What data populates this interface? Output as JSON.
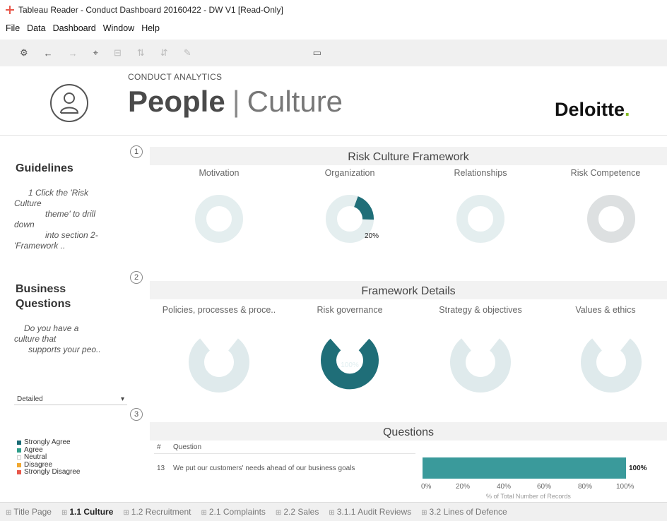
{
  "window": {
    "title": "Tableau Reader - Conduct Dashboard 20160422 - DW V1 [Read-Only]"
  },
  "menu": [
    "File",
    "Data",
    "Dashboard",
    "Window",
    "Help"
  ],
  "header": {
    "kicker": "CONDUCT ANALYTICS",
    "title_bold": "People",
    "title_sep": "|",
    "title_light": "Culture",
    "brand": "Deloitte",
    "brand_dot": ".",
    "brand_dot_color": "#86bc25"
  },
  "sidebar": {
    "guidelines_heading": "Guidelines",
    "guidelines_lines": [
      "1  Click the 'Risk",
      "Culture",
      "theme' to drill",
      "down",
      "into section 2-",
      "'Framework .."
    ],
    "business_heading_1": "Business",
    "business_heading_2": "Questions",
    "business_lines": [
      "Do you have a",
      "culture that",
      "supports your peo.."
    ],
    "filter_value": "Detailed",
    "legend": [
      {
        "label": "Strongly Agree",
        "color": "#1a6b75"
      },
      {
        "label": "Agree",
        "color": "#2e9e8a"
      },
      {
        "label": "Neutral",
        "color": "#ffffff"
      },
      {
        "label": "Disagree",
        "color": "#f0a830"
      },
      {
        "label": "Strongly Disagree",
        "color": "#e8574a"
      }
    ]
  },
  "section1": {
    "badge": "1",
    "title": "Risk Culture Framework",
    "columns": [
      "Motivation",
      "Organization",
      "Relationships",
      "Risk Competence"
    ],
    "highlight_label": "20%",
    "highlight_value": 0.2
  },
  "section2": {
    "badge": "2",
    "title": "Framework Details",
    "columns": [
      "Policies, processes & proce..",
      "Risk governance",
      "Strategy & objectives",
      "Values & ethics"
    ],
    "highlight_label": "100%",
    "highlight_value": 1.0
  },
  "section3": {
    "badge": "3",
    "title": "Questions",
    "col_num": "#",
    "col_question": "Question",
    "row": {
      "num": "13",
      "question": "We put our customers' needs ahead of our business goals",
      "value": 1.0,
      "label": "100%"
    },
    "axis_ticks": [
      "0%",
      "20%",
      "40%",
      "60%",
      "80%",
      "100%"
    ],
    "axis_label": "% of Total Number of Records"
  },
  "tabs": [
    {
      "label": "Title Page",
      "active": false
    },
    {
      "label": "1.1 Culture",
      "active": true
    },
    {
      "label": "1.2 Recruitment",
      "active": false
    },
    {
      "label": "2.1 Complaints",
      "active": false
    },
    {
      "label": "2.2 Sales",
      "active": false
    },
    {
      "label": "3.1.1 Audit Reviews",
      "active": false
    },
    {
      "label": "3.2 Lines of Defence",
      "active": false
    }
  ],
  "colors": {
    "accent": "#1f6e78",
    "donut_faded": "#dbe8ea",
    "donut_gray": "#d7dadc"
  }
}
